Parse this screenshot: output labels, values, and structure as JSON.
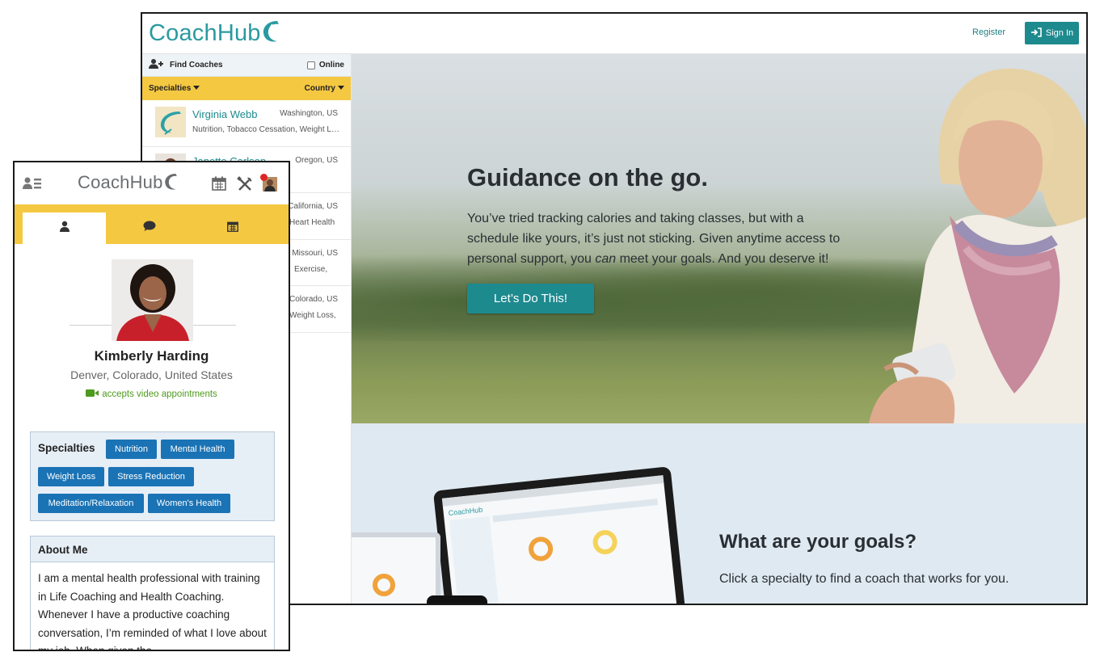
{
  "desktop": {
    "logo_text": "CoachHub",
    "register_label": "Register",
    "signin_label": "Sign In",
    "sidebar": {
      "find_label": "Find Coaches",
      "online_label": "Online",
      "specialties_label": "Specialties",
      "country_label": "Country",
      "coaches": [
        {
          "name": "Virginia Webb",
          "location": "Washington, US",
          "desc": "Nutrition, Tobacco Cessation, Weight Loss"
        },
        {
          "name": "Janette Carlson",
          "location": "Oregon, US",
          "desc": ""
        },
        {
          "name": "",
          "location": "California, US",
          "desc": "Heart Health"
        },
        {
          "name": "",
          "location": "Missouri, US",
          "desc": "Exercise,"
        },
        {
          "name": "",
          "location": "Colorado, US",
          "desc": "Weight Loss,"
        }
      ]
    },
    "hero": {
      "title": "Guidance on the go.",
      "body_1": "You’ve tried tracking calories and taking classes, but with a schedule like yours, it’s just not sticking. Given anytime access to personal support, you ",
      "body_em": "can",
      "body_2": " meet your goals. And you deserve it!",
      "cta": "Let’s Do This!"
    },
    "goals": {
      "title": "What are your goals?",
      "subtitle": "Click a specialty to find a coach that works for you."
    }
  },
  "mobile": {
    "logo_text": "CoachHub",
    "profile": {
      "name": "Kimberly Harding",
      "location": "Denver, Colorado, United States",
      "video_note": "accepts video appointments"
    },
    "specialties_title": "Specialties",
    "specialties": [
      "Nutrition",
      "Mental Health",
      "Weight Loss",
      "Stress Reduction",
      "Meditation/Relaxation",
      "Women's Health"
    ],
    "about_title": "About Me",
    "about_body": "I am a mental health professional with training in Life Coaching and Health Coaching. Whenever I have a productive coaching conversation, I’m reminded of what I love about my job. When given the"
  },
  "colors": {
    "teal": "#1d8a8e",
    "yellow": "#f5c842",
    "tag_blue": "#1a73b5",
    "video_green": "#4e9a1e"
  }
}
